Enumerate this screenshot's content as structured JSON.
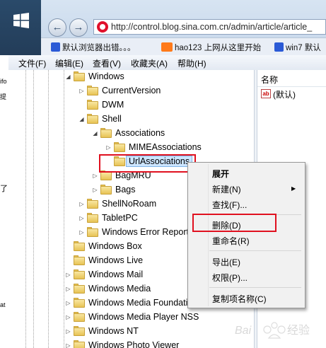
{
  "browser": {
    "address": "http://control.blog.sina.com.cn/admin/article/article_",
    "favorites": [
      "默认浏览器出错。。。",
      "hao123 上网从这里开始",
      "win7 默认"
    ]
  },
  "regedit": {
    "menu": [
      "文件(F)",
      "编辑(E)",
      "查看(V)",
      "收藏夹(A)",
      "帮助(H)"
    ],
    "tree": [
      {
        "label": "Windows",
        "indent": 0,
        "expander": "open"
      },
      {
        "label": "CurrentVersion",
        "indent": 1,
        "expander": "closed"
      },
      {
        "label": "DWM",
        "indent": 1,
        "expander": "none"
      },
      {
        "label": "Shell",
        "indent": 1,
        "expander": "open"
      },
      {
        "label": "Associations",
        "indent": 2,
        "expander": "open"
      },
      {
        "label": "MIMEAssociations",
        "indent": 3,
        "expander": "closed"
      },
      {
        "label": "UrlAssociations",
        "indent": 3,
        "expander": "none",
        "selected": true
      },
      {
        "label": "BagMRU",
        "indent": 2,
        "expander": "closed"
      },
      {
        "label": "Bags",
        "indent": 2,
        "expander": "closed"
      },
      {
        "label": "ShellNoRoam",
        "indent": 1,
        "expander": "closed"
      },
      {
        "label": "TabletPC",
        "indent": 1,
        "expander": "closed"
      },
      {
        "label": "Windows Error Report",
        "indent": 1,
        "expander": "closed"
      },
      {
        "label": "Windows Box",
        "indent": 0,
        "expander": "none"
      },
      {
        "label": "Windows Live",
        "indent": 0,
        "expander": "none"
      },
      {
        "label": "Windows Mail",
        "indent": 0,
        "expander": "closed"
      },
      {
        "label": "Windows Media",
        "indent": 0,
        "expander": "closed"
      },
      {
        "label": "Windows Media Foundatio",
        "indent": 0,
        "expander": "closed"
      },
      {
        "label": "Windows Media Player NSS",
        "indent": 0,
        "expander": "closed"
      },
      {
        "label": "Windows NT",
        "indent": 0,
        "expander": "closed"
      },
      {
        "label": "Windows Photo Viewer",
        "indent": 0,
        "expander": "closed"
      }
    ],
    "values_header": "名称",
    "value_icon": "ab",
    "value_name": "(默认)"
  },
  "context_menu": {
    "header": "展开",
    "new": "新建(N)",
    "find": "查找(F)...",
    "delete": "删除(D)",
    "rename": "重命名(R)",
    "export": "导出(E)",
    "permissions": "权限(P)...",
    "copy_key_name": "复制项名称(C)"
  },
  "peek_text": [
    "ifo",
    "提",
    "了",
    "at"
  ],
  "colors": {
    "highlight_box": "#e0101f",
    "selection": "#cce5ff"
  }
}
